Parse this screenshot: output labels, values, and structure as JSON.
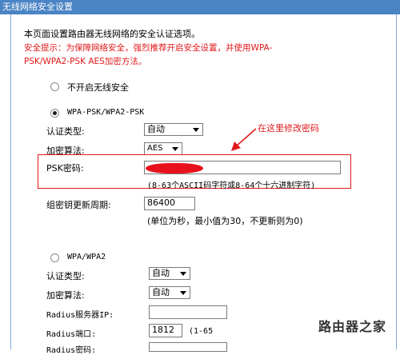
{
  "title": "无线网络安全设置",
  "intro": "本页面设置路由器无线网络的安全认证选项。",
  "tip_line1": "安全提示：为保障网络安全，强烈推荐开启安全设置，并使用WPA-",
  "tip_line2": "PSK/WPA2-PSK AES加密方法。",
  "no_security_label": "不开启无线安全",
  "wpa_psk": {
    "label": "WPA-PSK/WPA2-PSK",
    "auth_label": "认证类型:",
    "auth_value": "自动",
    "encrypt_label": "加密算法:",
    "encrypt_value": "AES",
    "psk_label": "PSK密码:",
    "psk_hint": "(8-63个ASCII码字符或8-64个十六进制字符)",
    "renew_label": "组密钥更新周期:",
    "renew_value": "86400",
    "renew_hint": "(单位为秒，最小值为30，不更新则为0)"
  },
  "annotation": "在这里修改密码",
  "wpa": {
    "label": "WPA/WPA2",
    "auth_label": "认证类型:",
    "auth_value": "自动",
    "encrypt_label": "加密算法:",
    "encrypt_value": "自动",
    "radius_ip_label": "Radius服务器IP:",
    "radius_port_label": "Radius端口:",
    "radius_port_value": "1812",
    "radius_port_hint": "(1-65",
    "radius_pwd_label": "Radius密码:"
  },
  "watermark": "路由器之家",
  "colors": {
    "titlebar": "#4a84c4",
    "warning": "#e0181a",
    "frame": "#7fa9d4"
  }
}
